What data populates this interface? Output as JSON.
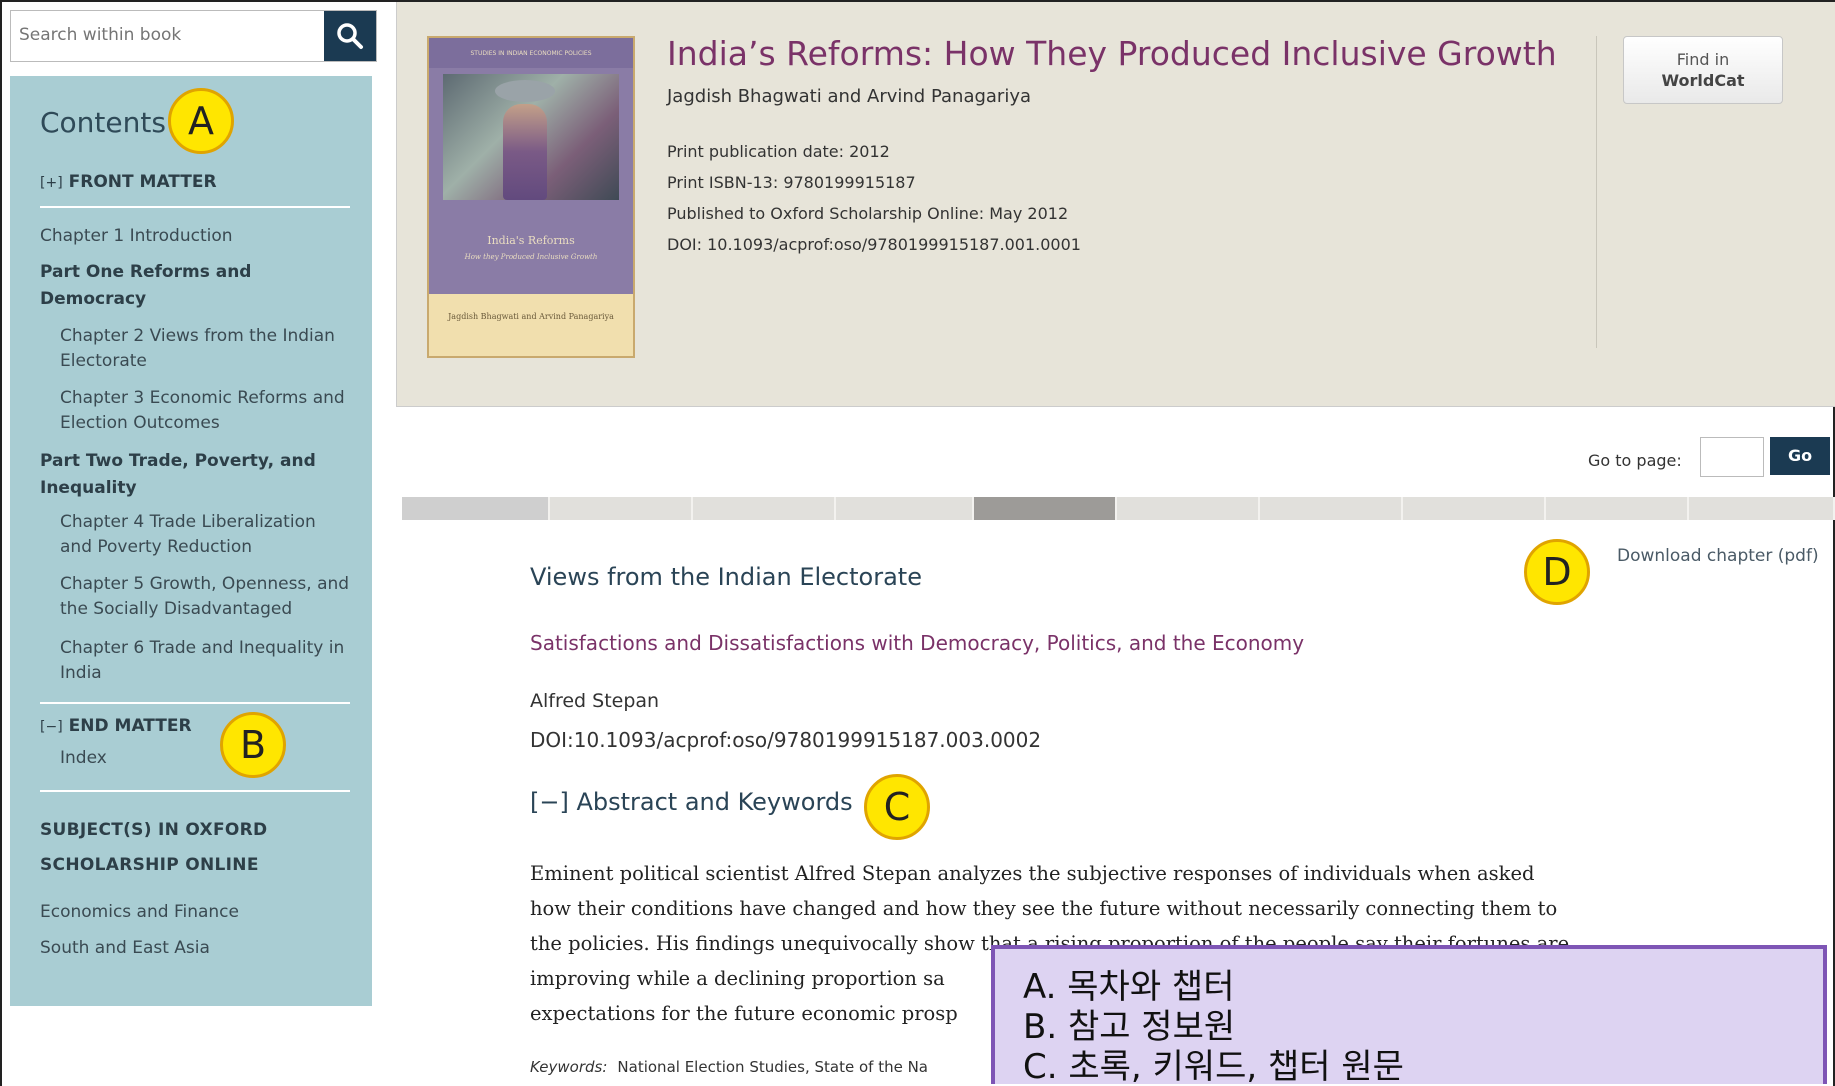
{
  "search": {
    "placeholder": "Search within book"
  },
  "sidebar": {
    "title": "Contents",
    "front_matter": {
      "toggle": "[+]",
      "label": "FRONT MATTER"
    },
    "chapter1": "Chapter 1 Introduction",
    "part1": "Part One Reforms and Democracy",
    "chapter2": "Chapter 2 Views from the Indian Electorate",
    "chapter3": "Chapter 3 Economic Reforms and Election Outcomes",
    "part2": "Part Two Trade, Poverty, and Inequality",
    "chapter4": "Chapter 4 Trade Liberalization and Poverty Reduction",
    "chapter5": "Chapter 5 Growth, Openness, and the Socially Disadvantaged",
    "chapter6": "Chapter 6 Trade and Inequality in India",
    "end_matter": {
      "toggle": "[−]",
      "label": "END MATTER"
    },
    "index": "Index",
    "subjects_heading_1": "SUBJECT(S) IN OXFORD",
    "subjects_heading_2": "SCHOLARSHIP ONLINE",
    "subjects": [
      "Economics and Finance",
      "South and East Asia"
    ]
  },
  "book": {
    "title": "India’s Reforms: How They Produced Inclusive Growth",
    "authors": "Jagdish Bhagwati and Arvind Panagariya",
    "print_date": "Print publication date: 2012",
    "isbn": "Print ISBN-13: 9780199915187",
    "published_online": "Published to Oxford Scholarship Online: May 2012",
    "doi": "DOI: 10.1093/acprof:oso/9780199915187.001.0001",
    "cover": {
      "series": "STUDIES IN INDIAN ECONOMIC POLICIES",
      "title": "India's Reforms",
      "subtitle": "How they Produced Inclusive Growth",
      "editors": "Jagdish Bhagwati and Arvind Panagariya"
    },
    "worldcat": {
      "line1": "Find in",
      "line2": "WorldCat"
    }
  },
  "goto": {
    "label": "Go to page:",
    "button": "Go"
  },
  "download": "Download chapter (pdf)",
  "chapter": {
    "title": "Views from the Indian Electorate",
    "subtitle": "Satisfactions and Dissatisfactions with Democracy, Politics, and the Economy",
    "author": "Alfred Stepan",
    "doi": "DOI:10.1093/acprof:oso/9780199915187.003.0002",
    "abstract_toggle": "[−] Abstract and Keywords",
    "abstract_lines": [
      "Eminent political scientist Alfred Stepan analyzes the subjective responses of individuals when asked",
      "how their conditions have changed and how they see the future without necessarily connecting them to",
      "the policies. His findings unequivocally show that a rising proportion of the people say their fortunes are",
      "improving while a declining proportion sa",
      "expectations for the future economic prosp"
    ],
    "keywords_label": "Keywords:",
    "keywords": "National Election Studies, State of the Na"
  },
  "markers": {
    "a": "A",
    "b": "B",
    "c": "C",
    "d": "D"
  },
  "legend": {
    "line_a": "A. 목차와 챕터",
    "line_b": "B. 참고 정보원",
    "line_c": "C. 초록, 키워드, 챕터 원문"
  },
  "colors": {
    "sidebar_bg": "#a9cdd3",
    "card_bg": "#e7e4d9",
    "accent_title": "#7a3268",
    "button_dark": "#1b3a52",
    "marker_yellow": "#ffe600",
    "legend_border": "#7e55b5",
    "legend_bg": "#ddd3f2"
  }
}
